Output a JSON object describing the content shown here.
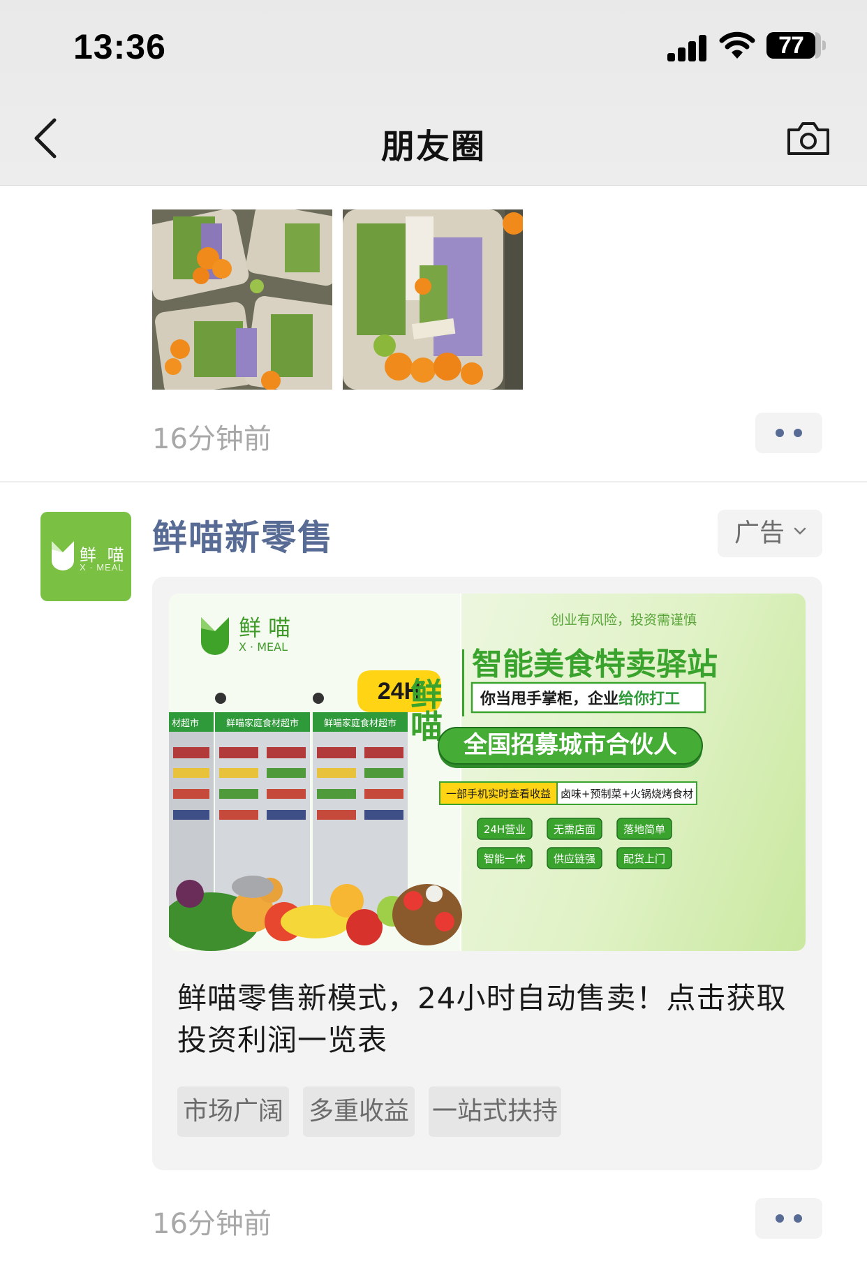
{
  "status_bar": {
    "time": "13:36",
    "battery": "77"
  },
  "nav": {
    "title": "朋友圈"
  },
  "post1": {
    "timestamp": "16分钟前"
  },
  "ad": {
    "author": "鲜喵新零售",
    "tag": "广告",
    "avatar": {
      "brand_cn": "鲜 喵",
      "brand_en": "X · MEAL"
    },
    "banner": {
      "brand_cn": "鲜 喵",
      "brand_en": "X · MEAL",
      "badge_24h": "24H",
      "risk_note": "创业有风险，投资需谨慎",
      "side_label": "鲜喵",
      "headline": "智能美食特卖驿站",
      "subline_prefix": "你当甩手掌柜，企业",
      "subline_highlight": "给你打工",
      "cta": "全国招募城市合伙人",
      "info_left": "一部手机实时查看收益",
      "info_right": "卤味+预制菜+火锅烧烤食材",
      "features": [
        "24H营业",
        "无需店面",
        "落地简单",
        "智能一体",
        "供应链强",
        "配货上门"
      ],
      "fridge_sign": "鲜喵家庭食材超市",
      "fridge_sign_partial": "材超市"
    },
    "description": "鲜喵零售新模式，24小时自动售卖！点击获取投资利润一览表",
    "chips": [
      "市场广阔",
      "多重收益",
      "一站式扶持"
    ],
    "timestamp": "16分钟前"
  },
  "colors": {
    "link_blue": "#576b95",
    "brand_green": "#7ac143",
    "dark_green": "#3f9a2a",
    "badge_yellow": "#ffd414"
  }
}
